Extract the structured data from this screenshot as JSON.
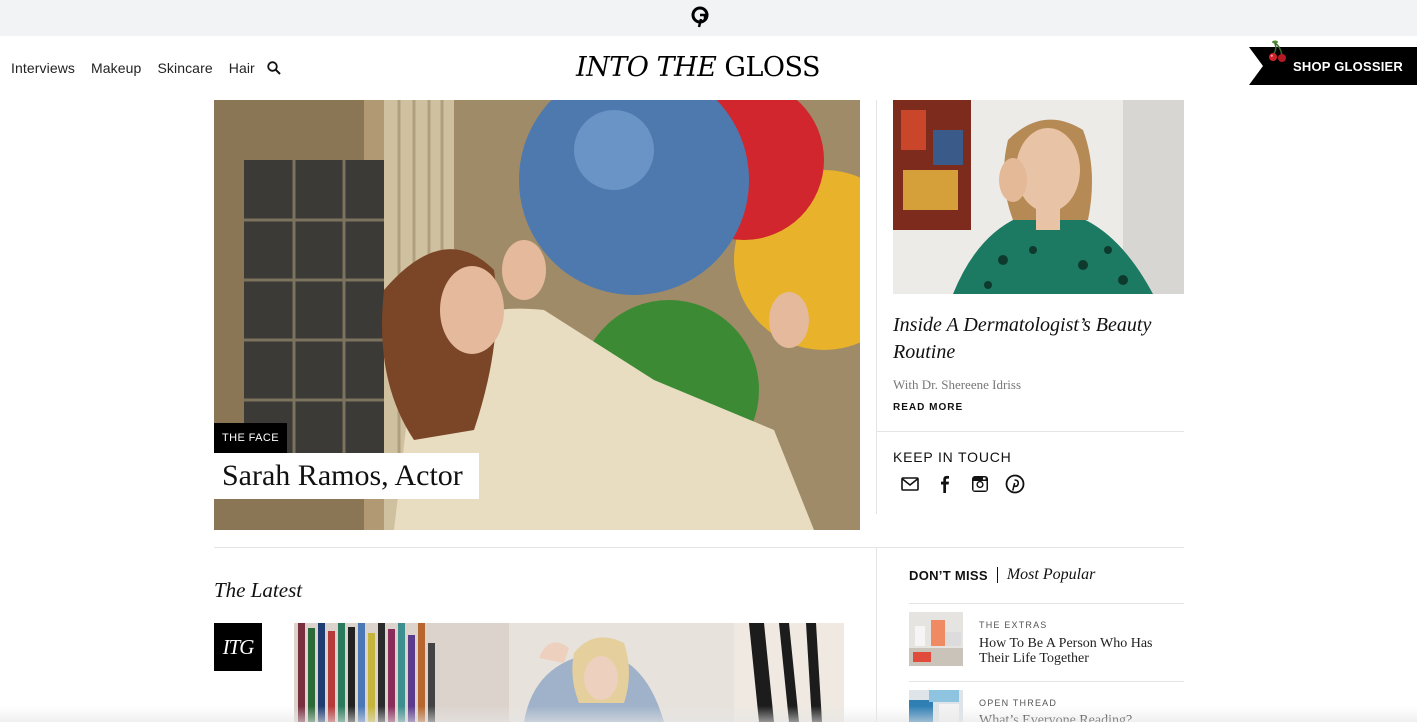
{
  "nav": {
    "links": [
      "Interviews",
      "Makeup",
      "Skincare",
      "Hair"
    ],
    "brand_italic": "INTO THE",
    "brand_plain": "GLOSS",
    "shop_label": "SHOP GLOSSIER"
  },
  "hero": {
    "tag": "THE FACE",
    "title": "Sarah Ramos, Actor"
  },
  "side_story": {
    "title": "Inside A Dermatologist’s Beauty Routine",
    "subtitle": "With Dr. Shereene Idriss",
    "read_more": "READ MORE"
  },
  "keep_in_touch": {
    "title": "KEEP IN TOUCH",
    "icons": [
      "mail-icon",
      "facebook-icon",
      "instagram-icon",
      "pinterest-icon"
    ]
  },
  "latest": {
    "heading": "The Latest",
    "badge": "ITG"
  },
  "dont_miss": {
    "tab_active": "DON’T MISS",
    "tab_other": "Most Popular",
    "items": [
      {
        "category": "THE EXTRAS",
        "title": "How To Be A Person Who Has Their Life Together"
      },
      {
        "category": "OPEN THREAD",
        "title": "What’s Everyone Reading?"
      }
    ]
  },
  "colors": {
    "top_strip": "#f1f3f4",
    "black": "#000000",
    "divider": "#e4e4e4"
  }
}
